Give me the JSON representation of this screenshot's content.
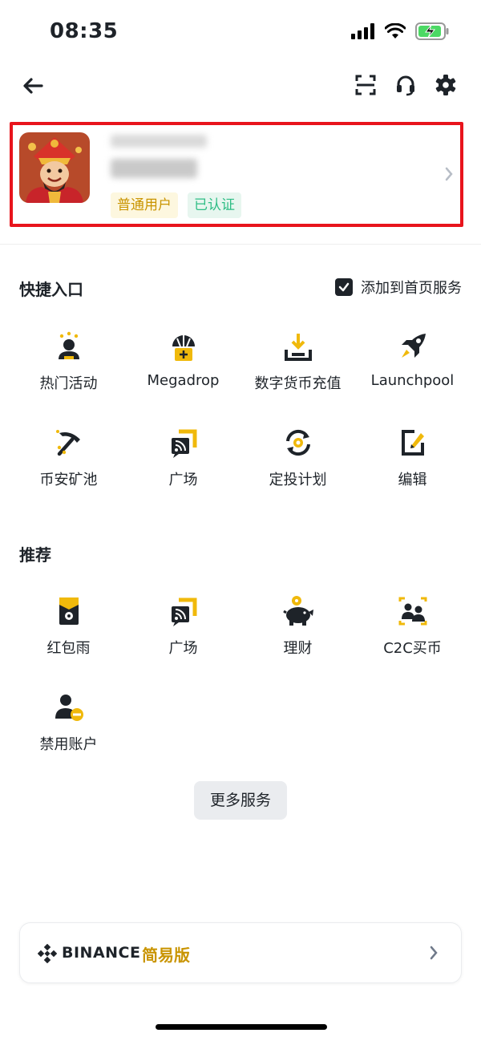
{
  "status_bar": {
    "time": "08:35"
  },
  "profile": {
    "badge_user": "普通用户",
    "badge_verified": "已认证"
  },
  "quick_access": {
    "title": "快捷入口",
    "add_to_home_label": "添加到首页服务",
    "add_to_home_checked": true,
    "items": [
      {
        "label": "热门活动",
        "icon": "hot-activity-icon"
      },
      {
        "label": "Megadrop",
        "icon": "megadrop-icon"
      },
      {
        "label": "数字货币充值",
        "icon": "deposit-icon"
      },
      {
        "label": "Launchpool",
        "icon": "rocket-icon"
      },
      {
        "label": "币安矿池",
        "icon": "pickaxe-icon"
      },
      {
        "label": "广场",
        "icon": "square-feed-icon"
      },
      {
        "label": "定投计划",
        "icon": "auto-invest-icon"
      },
      {
        "label": "编辑",
        "icon": "edit-icon"
      }
    ]
  },
  "recommend": {
    "title": "推荐",
    "items": [
      {
        "label": "红包雨",
        "icon": "red-packet-icon"
      },
      {
        "label": "广场",
        "icon": "square-feed-icon"
      },
      {
        "label": "理财",
        "icon": "piggy-bank-icon"
      },
      {
        "label": "C2C买币",
        "icon": "c2c-users-icon"
      },
      {
        "label": "禁用账户",
        "icon": "disable-account-icon"
      }
    ]
  },
  "more_services_label": "更多服务",
  "lite": {
    "brand": "BINANCE",
    "mode": "简易版"
  },
  "colors": {
    "accent": "#F0B90B",
    "dark": "#1E2329",
    "highlight_border": "#E8141C",
    "verified": "#2EBD85"
  }
}
